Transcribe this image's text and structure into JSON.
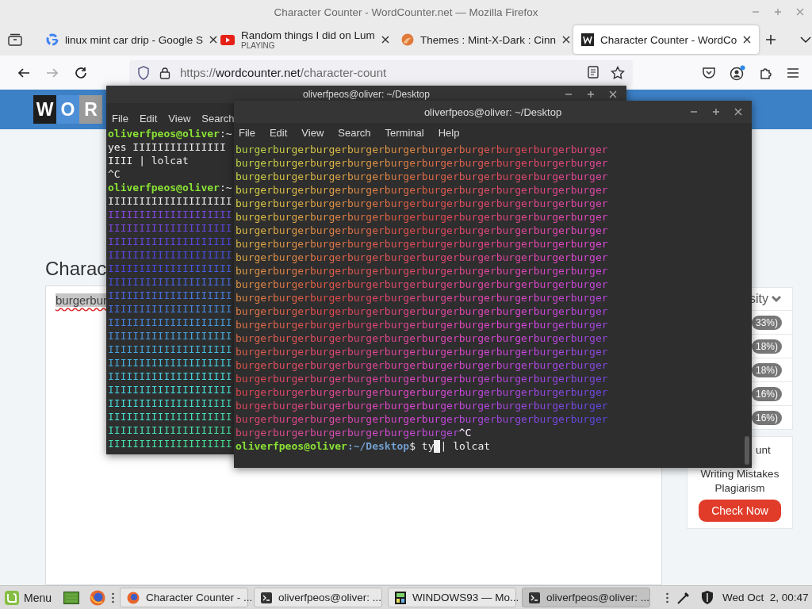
{
  "browser": {
    "title": "Character Counter - WordCounter.net — Mozilla Firefox",
    "tabs": [
      {
        "label": "linux mint car drip - Google S",
        "kind": "google",
        "selected": false
      },
      {
        "label": "Random things I did on Lum",
        "sublabel": "PLAYING",
        "kind": "youtube",
        "selected": false
      },
      {
        "label": "Themes : Mint-X-Dark : Cinn",
        "kind": "themes",
        "selected": false
      },
      {
        "label": "Character Counter - WordCo",
        "kind": "wordcounter",
        "selected": true
      }
    ],
    "forward_disabled": true,
    "url": {
      "scheme": "https://",
      "domain": "wordcounter.net",
      "path": "/character-count"
    }
  },
  "page": {
    "logo_letters": [
      "W",
      "O",
      "R"
    ],
    "heading": "Charac",
    "editor_text": "burgerbur",
    "sidebar_header": "sity",
    "percentages": [
      "33%)",
      "18%)",
      "18%)",
      "16%)",
      "16%)"
    ],
    "promo_lines": [
      "unt",
      "Writing Mistakes",
      "Plagiarism"
    ],
    "promo_button": "Check Now"
  },
  "back_terminal": {
    "title": "oliverfpeos@oliver: ~/Desktop",
    "menu": [
      "File",
      "Edit",
      "View",
      "Search"
    ],
    "lines": [
      {
        "kind": "prompt",
        "user_host": "oliverfpeos@oliver",
        "rest": ":~"
      },
      {
        "kind": "plain",
        "text": "yes IIIIIIIIIIIIIII"
      },
      {
        "kind": "plain",
        "text": "IIII | lolcat"
      },
      {
        "kind": "plain",
        "text": "^C"
      },
      {
        "kind": "prompt",
        "user_host": "oliverfpeos@oliver",
        "rest": ":~"
      },
      {
        "kind": "plain",
        "text": "IIIIIIIIIIIIIIIIIIII"
      },
      {
        "kind": "rainbow",
        "text": "IIIIIIIIIIIIIIIIIIII"
      },
      {
        "kind": "rainbow",
        "text": "IIIIIIIIIIIIIIIIIIII"
      },
      {
        "kind": "rainbow",
        "text": "IIIIIIIIIIIIIIIIIIII"
      },
      {
        "kind": "rainbow",
        "text": "IIIIIIIIIIIIIIIIIIII"
      },
      {
        "kind": "rainbow",
        "text": "IIIIIIIIIIIIIIIIIIII"
      },
      {
        "kind": "rainbow",
        "text": "IIIIIIIIIIIIIIIIIIII"
      },
      {
        "kind": "rainbow",
        "text": "IIIIIIIIIIIIIIIIIIII"
      },
      {
        "kind": "rainbow",
        "text": "IIIIIIIIIIIIIIIIIIII"
      },
      {
        "kind": "rainbow",
        "text": "IIIIIIIIIIIIIIIIIIII"
      },
      {
        "kind": "rainbow",
        "text": "IIIIIIIIIIIIIIIIIIII"
      },
      {
        "kind": "rainbow",
        "text": "IIIIIIIIIIIIIIIIIIII"
      },
      {
        "kind": "rainbow",
        "text": "IIIIIIIIIIIIIIIIIIII"
      },
      {
        "kind": "rainbow",
        "text": "IIIIIIIIIIIIIIIIIIII"
      },
      {
        "kind": "rainbow",
        "text": "IIIIIIIIIIIIIIIIIIII"
      },
      {
        "kind": "rainbow",
        "text": "IIIIIIIIIIIIIIIIIIII"
      },
      {
        "kind": "rainbow",
        "text": "IIIIIIIIIIIIIIIIIIII"
      },
      {
        "kind": "rainbow",
        "text": "IIIIIIIIIIIIIIIIIIII"
      },
      {
        "kind": "rainbow",
        "text": "IIIIIIIIIIIIIIIIIIII"
      }
    ]
  },
  "front_terminal": {
    "title": "oliverfpeos@oliver: ~/Desktop",
    "menu": [
      "File",
      "Edit",
      "View",
      "Search",
      "Terminal",
      "Help"
    ],
    "lines": [
      {
        "kind": "rainbow",
        "text": "burgerburgerburgerburgerburgerburgerburgerburgerburgerburger"
      },
      {
        "kind": "rainbow",
        "text": "burgerburgerburgerburgerburgerburgerburgerburgerburgerburger"
      },
      {
        "kind": "rainbow",
        "text": "burgerburgerburgerburgerburgerburgerburgerburgerburgerburger"
      },
      {
        "kind": "rainbow",
        "text": "burgerburgerburgerburgerburgerburgerburgerburgerburgerburger"
      },
      {
        "kind": "rainbow",
        "text": "burgerburgerburgerburgerburgerburgerburgerburgerburgerburger"
      },
      {
        "kind": "rainbow",
        "text": "burgerburgerburgerburgerburgerburgerburgerburgerburgerburger"
      },
      {
        "kind": "rainbow",
        "text": "burgerburgerburgerburgerburgerburgerburgerburgerburgerburger"
      },
      {
        "kind": "rainbow",
        "text": "burgerburgerburgerburgerburgerburgerburgerburgerburgerburger"
      },
      {
        "kind": "rainbow",
        "text": "burgerburgerburgerburgerburgerburgerburgerburgerburgerburger"
      },
      {
        "kind": "rainbow",
        "text": "burgerburgerburgerburgerburgerburgerburgerburgerburgerburger"
      },
      {
        "kind": "rainbow",
        "text": "burgerburgerburgerburgerburgerburgerburgerburgerburgerburger"
      },
      {
        "kind": "rainbow",
        "text": "burgerburgerburgerburgerburgerburgerburgerburgerburgerburger"
      },
      {
        "kind": "rainbow",
        "text": "burgerburgerburgerburgerburgerburgerburgerburgerburgerburger"
      },
      {
        "kind": "rainbow",
        "text": "burgerburgerburgerburgerburgerburgerburgerburgerburgerburger"
      },
      {
        "kind": "rainbow",
        "text": "burgerburgerburgerburgerburgerburgerburgerburgerburgerburger"
      },
      {
        "kind": "rainbow",
        "text": "burgerburgerburgerburgerburgerburgerburgerburgerburgerburger"
      },
      {
        "kind": "rainbow",
        "text": "burgerburgerburgerburgerburgerburgerburgerburgerburgerburger"
      },
      {
        "kind": "rainbow",
        "text": "burgerburgerburgerburgerburgerburgerburgerburgerburgerburger"
      },
      {
        "kind": "rainbow",
        "text": "burgerburgerburgerburgerburgerburgerburgerburgerburgerburger"
      },
      {
        "kind": "rainbow",
        "text": "burgerburgerburgerburgerburgerburgerburgerburgerburgerburger"
      },
      {
        "kind": "rainbow",
        "text": "burgerburgerburgerburgerburgerburgerburgerburgerburgerburger"
      },
      {
        "kind": "rainbow",
        "text": "burgerburgerburgerburgerburgerburger",
        "tail": "^C"
      },
      {
        "kind": "command",
        "user_host": "oliverfpeos@oliver",
        "rest": ":~/Desktop",
        "before_cursor": "$ ty",
        "after_cursor": "| lolcat"
      }
    ]
  },
  "taskbar": {
    "menu_label": "Menu",
    "windows": [
      {
        "label": "Character Counter - ...",
        "kind": "firefox",
        "selected": false
      },
      {
        "label": "oliverfpeos@oliver: ...",
        "kind": "terminal",
        "selected": false
      },
      {
        "label": "WINDOWS93 — Mo...",
        "kind": "app",
        "selected": false
      },
      {
        "label": "oliverfpeos@oliver: ...",
        "kind": "terminal",
        "selected": true
      }
    ],
    "clock": "Wed Oct  2, 00:47"
  }
}
